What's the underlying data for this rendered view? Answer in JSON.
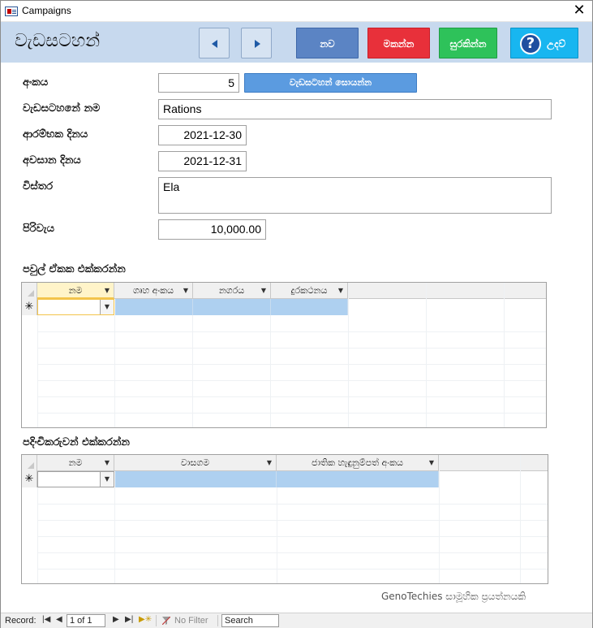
{
  "window": {
    "title": "Campaigns",
    "close_glyph": "✕"
  },
  "header": {
    "form_title": "වැඩසටහන්",
    "prev_icon": "left-triangle",
    "next_icon": "right-triangle",
    "new_label": "නව",
    "delete_label": "මකන්න",
    "save_label": "සුරකින්න",
    "help_label": "උදව්",
    "help_glyph": "?",
    "colors": {
      "header_bg": "#c7d9ee",
      "new": "#5b84c4",
      "delete": "#e8303a",
      "save": "#2ec25a",
      "help": "#18b6f0"
    }
  },
  "fields": {
    "number": {
      "label": "අංකය",
      "value": "5"
    },
    "search_button": "වැඩසටහන් සොයන්න",
    "name": {
      "label": "වැඩසටහනේ නම",
      "value": "Rations"
    },
    "start_date": {
      "label": "ආරම්භක දිනය",
      "value": "2021-12-30"
    },
    "end_date": {
      "label": "අවසාන දිනය",
      "value": "2021-12-31"
    },
    "details": {
      "label": "විස්තර",
      "value": "Ela"
    },
    "cost": {
      "label": "පිරිවැය",
      "value": "10,000.00"
    }
  },
  "families_grid": {
    "section_label": "පවුල් ඒකක එක්කරන්න",
    "columns": [
      "නම",
      "ගෘහ අංකය",
      "නගරය",
      "දුරකථනය"
    ],
    "new_row_marker": "✳"
  },
  "volunteers_grid": {
    "section_label": "පදිංචිකරුවන් එක්කරන්න",
    "columns": [
      "නම",
      "වාසගම",
      "ජාතික හැඳුනුම්පත් අංකය"
    ],
    "new_row_marker": "✳"
  },
  "footer_credit": "GenoTechies සාමූහික ප්‍රයත්නයකි",
  "statusbar": {
    "record_label": "Record:",
    "record_value": "1 of 1",
    "no_filter": "No Filter",
    "search_placeholder": "Search"
  }
}
